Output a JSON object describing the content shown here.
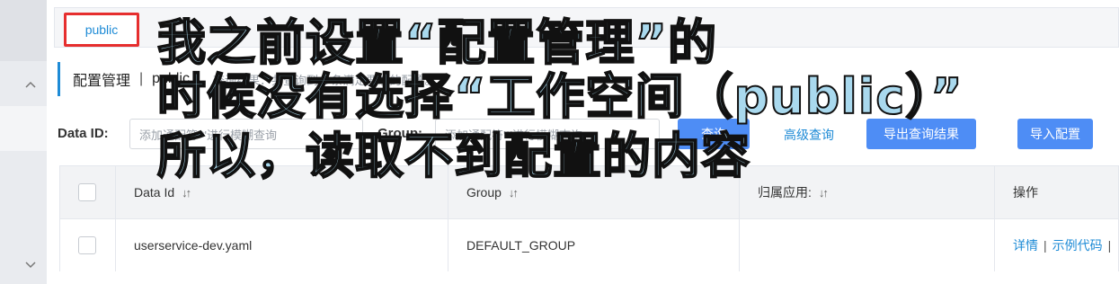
{
  "namespace": {
    "active": "public"
  },
  "title": {
    "main": "配置管理",
    "separator": "|",
    "namespace": "public",
    "hint": "查询结果：共查询到 1 条满足要求的配置。"
  },
  "filters": {
    "data_id_label": "Data ID:",
    "data_id_placeholder": "添加通配符'*'进行模糊查询",
    "group_label": "Group:",
    "group_placeholder": "添加通配符'*'进行模糊查询",
    "query_button": "查询",
    "advanced_query": "高级查询",
    "export_button": "导出查询结果",
    "import_button": "导入配置"
  },
  "table": {
    "headers": {
      "data_id": "Data Id",
      "group": "Group",
      "app": "归属应用:",
      "ops": "操作"
    },
    "rows": [
      {
        "data_id": "userservice-dev.yaml",
        "group": "DEFAULT_GROUP",
        "app": "",
        "op_detail": "详情",
        "op_sample": "示例代码",
        "op_sep": "|"
      }
    ]
  },
  "overlay": {
    "line1": "我之前设置“配置管理”的",
    "line2": "时候没有选择“工作空间（public）”",
    "line3": "所以，读取不到配置的内容"
  },
  "icons": {
    "sidebar_top": "chevron-up-icon",
    "sidebar_bottom": "chevron-down-icon",
    "sort": "sort-icon"
  },
  "colors": {
    "accent": "#1e8bd6",
    "primary_button": "#4e8df5",
    "highlight_box": "#e62e2e",
    "overlay_text": "#a9d9ee"
  }
}
